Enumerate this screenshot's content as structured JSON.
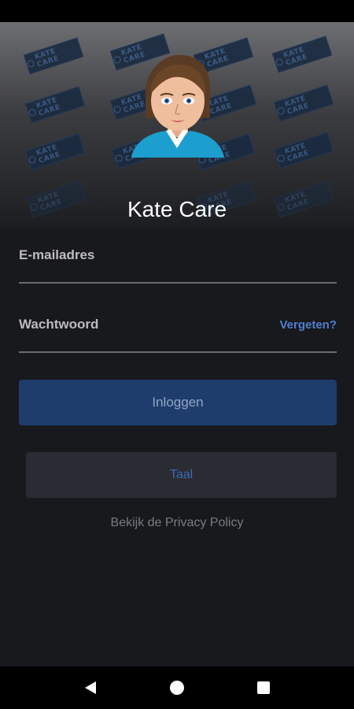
{
  "app": {
    "title": "Kate Care",
    "watermark_text": "KATE CARE"
  },
  "form": {
    "email": {
      "placeholder": "E-mailadres",
      "value": ""
    },
    "password": {
      "placeholder": "Wachtwoord",
      "value": ""
    },
    "forgot_label": "Vergeten?"
  },
  "buttons": {
    "login_label": "Inloggen",
    "language_label": "Taal",
    "privacy_label": "Bekijk de Privacy Policy"
  },
  "navigation": {
    "back_icon": "back-triangle-icon",
    "home_icon": "home-circle-icon",
    "recents_icon": "recents-square-icon"
  },
  "colors": {
    "background": "#18191d",
    "accent": "#4f7fd0",
    "login_button": "#1f3d6c",
    "language_button": "#2b2c33"
  }
}
